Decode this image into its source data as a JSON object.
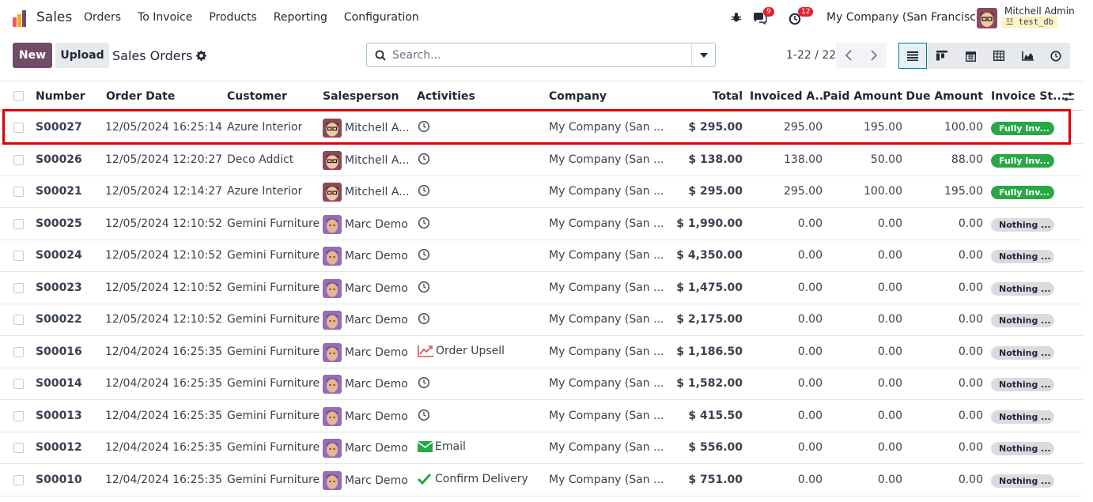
{
  "topbar": {
    "app_name": "Sales",
    "menu": [
      "Orders",
      "To Invoice",
      "Products",
      "Reporting",
      "Configuration"
    ],
    "messages_count": "9",
    "activities_count": "12",
    "company": "My Company (San Francisco)",
    "user_name": "Mitchell Admin",
    "db_name": "test_db"
  },
  "control": {
    "new_label": "New",
    "upload_label": "Upload",
    "title": "Sales Orders",
    "search_placeholder": "Search...",
    "pager": "1-22 / 22"
  },
  "table": {
    "headers": [
      "Number",
      "Order Date",
      "Customer",
      "Salesperson",
      "Activities",
      "Company",
      "Total",
      "Invoiced A...",
      "Paid Amount",
      "Due Amount",
      "Invoice St..."
    ],
    "rows": [
      {
        "number": "S00027",
        "date": "12/05/2024 16:25:14",
        "customer": "Azure Interior",
        "salesperson": "Mitchell A...",
        "activity": "",
        "company": "My Company (San ...",
        "total": "$ 295.00",
        "invoiced": "295.00",
        "paid": "195.00",
        "due": "100.00",
        "status": "Fully Inv..."
      },
      {
        "number": "S00026",
        "date": "12/05/2024 12:20:27",
        "customer": "Deco Addict",
        "salesperson": "Mitchell A...",
        "activity": "",
        "company": "My Company (San ...",
        "total": "$ 138.00",
        "invoiced": "138.00",
        "paid": "50.00",
        "due": "88.00",
        "status": "Fully Inv..."
      },
      {
        "number": "S00021",
        "date": "12/05/2024 12:14:27",
        "customer": "Azure Interior",
        "salesperson": "Mitchell A...",
        "activity": "",
        "company": "My Company (San ...",
        "total": "$ 295.00",
        "invoiced": "295.00",
        "paid": "100.00",
        "due": "195.00",
        "status": "Fully Inv..."
      },
      {
        "number": "S00025",
        "date": "12/05/2024 12:10:52",
        "customer": "Gemini Furniture",
        "salesperson": "Marc Demo",
        "activity": "",
        "company": "My Company (San ...",
        "total": "$ 1,990.00",
        "invoiced": "0.00",
        "paid": "0.00",
        "due": "0.00",
        "status": "Nothing ..."
      },
      {
        "number": "S00024",
        "date": "12/05/2024 12:10:52",
        "customer": "Gemini Furniture",
        "salesperson": "Marc Demo",
        "activity": "",
        "company": "My Company (San ...",
        "total": "$ 4,350.00",
        "invoiced": "0.00",
        "paid": "0.00",
        "due": "0.00",
        "status": "Nothing ..."
      },
      {
        "number": "S00023",
        "date": "12/05/2024 12:10:52",
        "customer": "Gemini Furniture",
        "salesperson": "Marc Demo",
        "activity": "",
        "company": "My Company (San ...",
        "total": "$ 1,475.00",
        "invoiced": "0.00",
        "paid": "0.00",
        "due": "0.00",
        "status": "Nothing ..."
      },
      {
        "number": "S00022",
        "date": "12/05/2024 12:10:52",
        "customer": "Gemini Furniture",
        "salesperson": "Marc Demo",
        "activity": "",
        "company": "My Company (San ...",
        "total": "$ 2,175.00",
        "invoiced": "0.00",
        "paid": "0.00",
        "due": "0.00",
        "status": "Nothing ..."
      },
      {
        "number": "S00016",
        "date": "12/04/2024 16:25:35",
        "customer": "Gemini Furniture",
        "salesperson": "Marc Demo",
        "activity": "Order Upsell",
        "company": "My Company (San ...",
        "total": "$ 1,186.50",
        "invoiced": "0.00",
        "paid": "0.00",
        "due": "0.00",
        "status": "Nothing ..."
      },
      {
        "number": "S00014",
        "date": "12/04/2024 16:25:35",
        "customer": "Gemini Furniture",
        "salesperson": "Marc Demo",
        "activity": "",
        "company": "My Company (San ...",
        "total": "$ 1,582.00",
        "invoiced": "0.00",
        "paid": "0.00",
        "due": "0.00",
        "status": "Nothing ..."
      },
      {
        "number": "S00013",
        "date": "12/04/2024 16:25:35",
        "customer": "Gemini Furniture",
        "salesperson": "Marc Demo",
        "activity": "",
        "company": "My Company (San ...",
        "total": "$ 415.50",
        "invoiced": "0.00",
        "paid": "0.00",
        "due": "0.00",
        "status": "Nothing ..."
      },
      {
        "number": "S00012",
        "date": "12/04/2024 16:25:35",
        "customer": "Gemini Furniture",
        "salesperson": "Marc Demo",
        "activity": "Email",
        "company": "My Company (San ...",
        "total": "$ 556.00",
        "invoiced": "0.00",
        "paid": "0.00",
        "due": "0.00",
        "status": "Nothing ..."
      },
      {
        "number": "S00010",
        "date": "12/04/2024 16:25:35",
        "customer": "Gemini Furniture",
        "salesperson": "Marc Demo",
        "activity": "Confirm Delivery",
        "company": "My Company (San ...",
        "total": "$ 751.00",
        "invoiced": "0.00",
        "paid": "0.00",
        "due": "0.00",
        "status": "Nothing ..."
      }
    ]
  },
  "colors": {
    "brand": "#714b67",
    "accent": "#017e84",
    "status_green": "#28a745",
    "highlight": "#e00000"
  }
}
